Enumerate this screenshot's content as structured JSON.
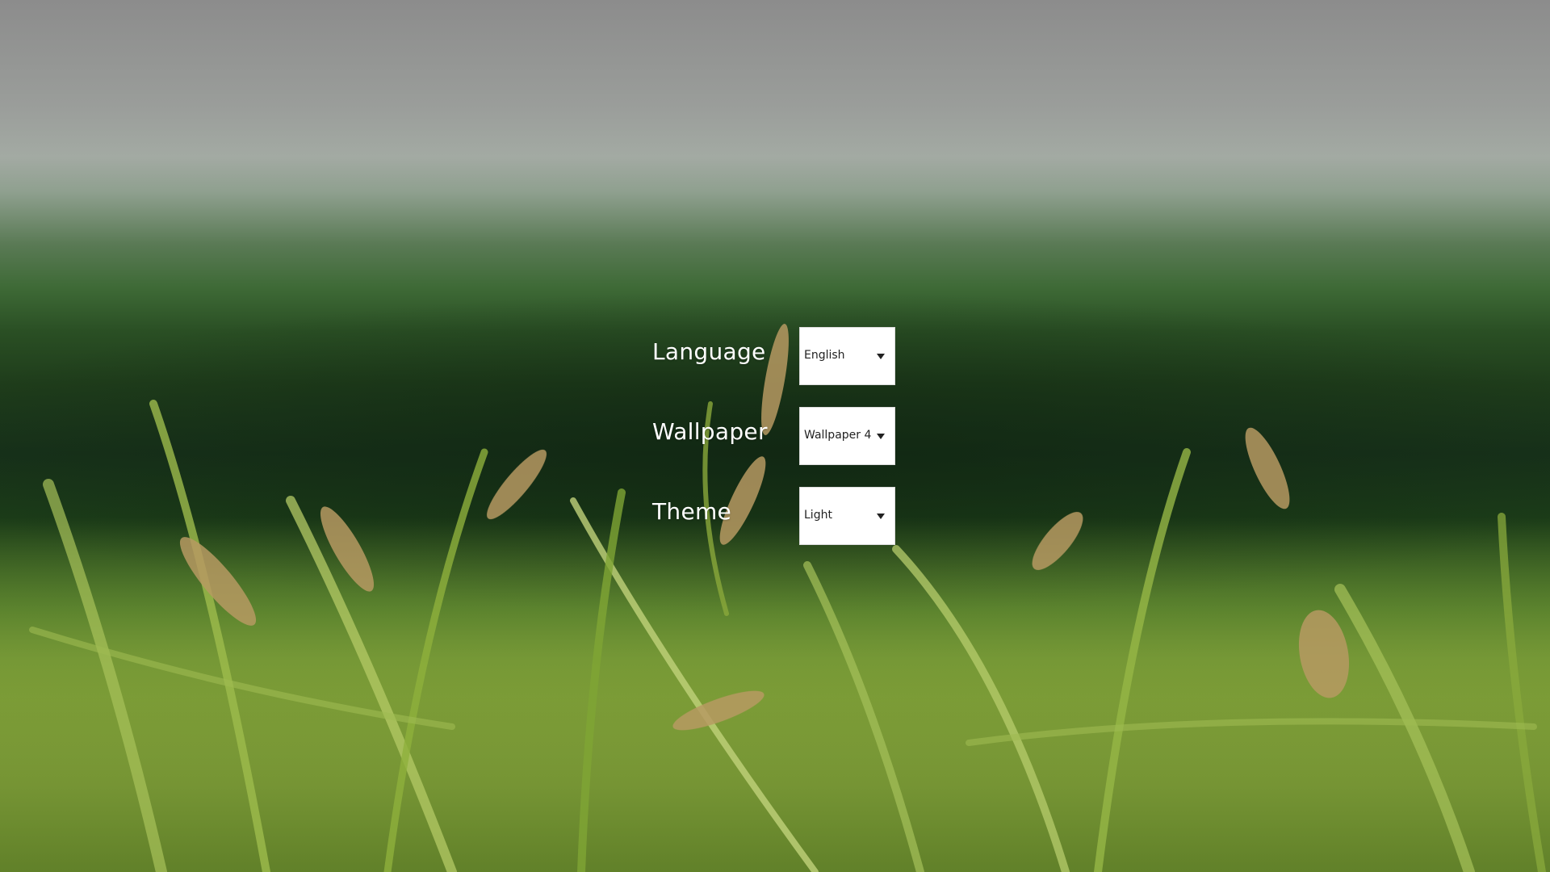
{
  "background": {
    "wallpaper_icon": "grass-landscape-image"
  },
  "settings": {
    "rows": [
      {
        "label": "Language",
        "value": "English"
      },
      {
        "label": "Wallpaper",
        "value": "Wallpaper 4"
      },
      {
        "label": "Theme",
        "value": "Light"
      }
    ]
  },
  "colors": {
    "label_text": "#ffffff",
    "select_bg": "#ffffff",
    "select_text": "#222222"
  }
}
